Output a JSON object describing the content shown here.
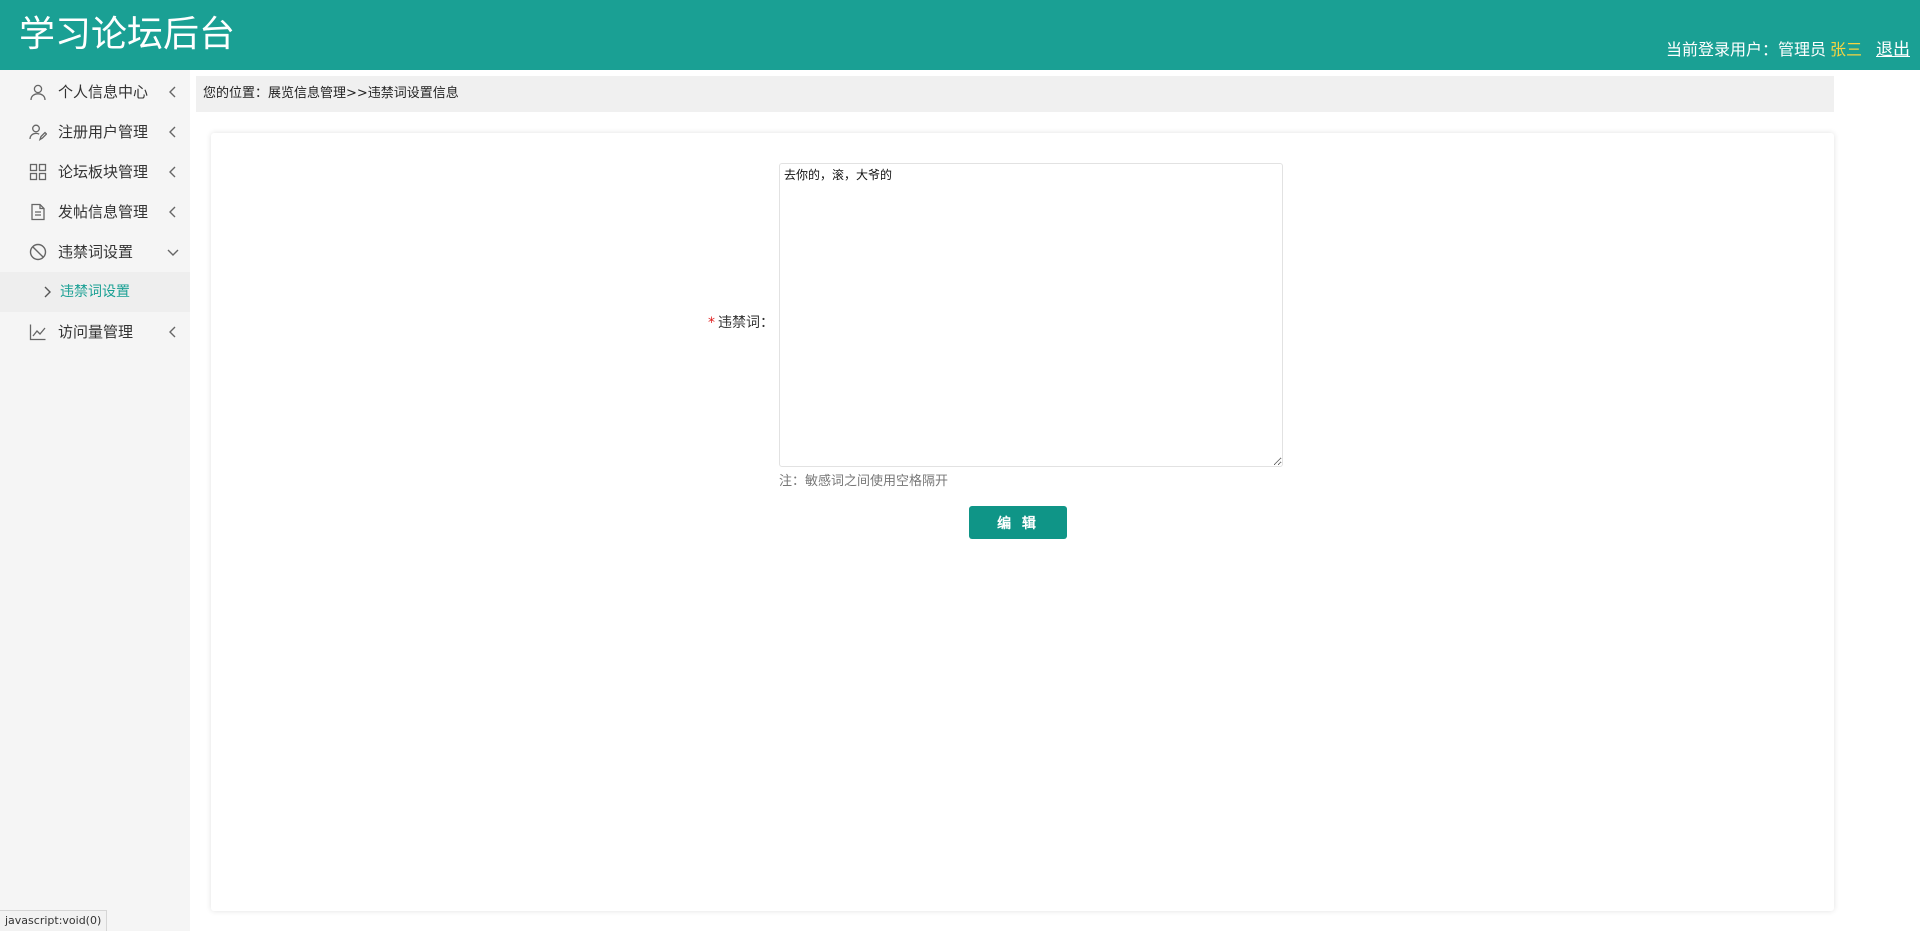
{
  "header": {
    "title": "学习论坛后台",
    "user_prefix": "当前登录用户：管理员",
    "user_name": "张三",
    "logout": "退出"
  },
  "sidebar": {
    "items": [
      {
        "label": "个人信息中心",
        "icon": "user-icon",
        "arrow": "chevron-left"
      },
      {
        "label": "注册用户管理",
        "icon": "user-edit-icon",
        "arrow": "chevron-left"
      },
      {
        "label": "论坛板块管理",
        "icon": "grid-icon",
        "arrow": "chevron-left"
      },
      {
        "label": "发帖信息管理",
        "icon": "document-icon",
        "arrow": "chevron-left"
      },
      {
        "label": "违禁词设置",
        "icon": "ban-icon",
        "arrow": "chevron-down"
      },
      {
        "label": "访问量管理",
        "icon": "line-chart-icon",
        "arrow": "chevron-left"
      }
    ],
    "active_sub": {
      "label": "违禁词设置"
    }
  },
  "breadcrumb": {
    "text": "您的位置：展览信息管理>>违禁词设置信息"
  },
  "form": {
    "label": "违禁词：",
    "required_mark": "*",
    "textarea_value": "去你的，滚，大爷的",
    "note": "注：敏感词之间使用空格隔开",
    "submit_label": "编 辑"
  },
  "statusbar": {
    "text": "javascript:void(0)"
  },
  "colors": {
    "header_bg": "#1aa094",
    "accent": "#0f9587",
    "user_name": "#f5d442",
    "sidebar_bg": "#f5f5f5"
  }
}
